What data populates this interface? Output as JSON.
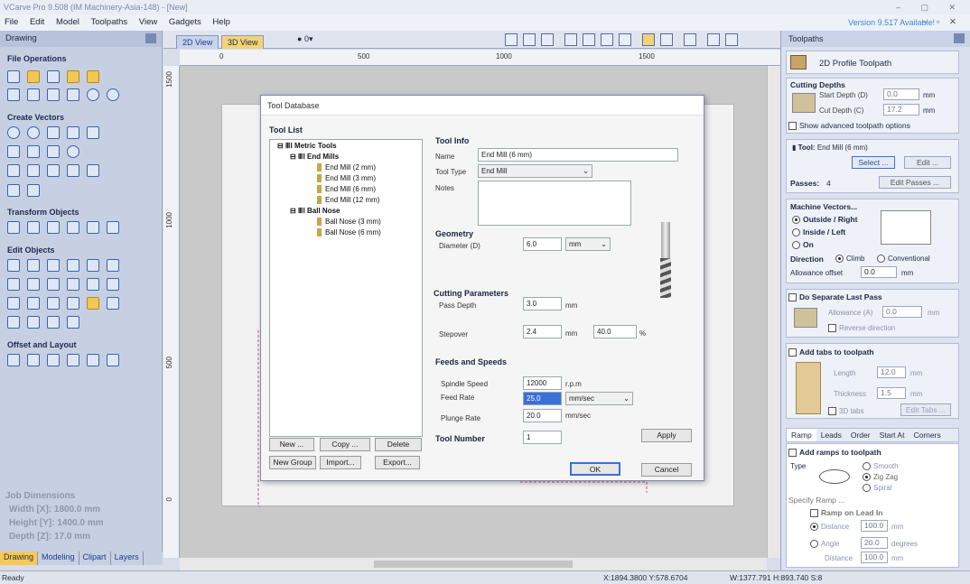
{
  "window": {
    "title": "VCarve Pro 9.508 (IM Machinery-Asia-148) - [New]",
    "version_notice": "Version 9.517 Available!"
  },
  "menu": [
    "File",
    "Edit",
    "Model",
    "Toolpaths",
    "View",
    "Gadgets",
    "Help"
  ],
  "left_panel": {
    "header": "Drawing",
    "sections": {
      "file_operations": "File Operations",
      "create_vectors": "Create Vectors",
      "transform_objects": "Transform Objects",
      "edit_objects": "Edit Objects",
      "offset_layout": "Offset and Layout"
    },
    "job_dimensions": {
      "title": "Job Dimensions",
      "width": "Width  [X]: 1800.0 mm",
      "height": "Height [Y]: 1400.0 mm",
      "depth": "Depth  [Z]: 17.0 mm"
    },
    "tabs": [
      "Drawing",
      "Modeling",
      "Clipart",
      "Layers"
    ],
    "active_tab": "Drawing"
  },
  "view_tabs": {
    "tab2d": "2D View",
    "tab3d": "3D View",
    "layer_label": "0"
  },
  "ruler": {
    "h": [
      "0",
      "500",
      "1000",
      "1500"
    ],
    "v": [
      "1500",
      "1000",
      "500",
      "0"
    ]
  },
  "status": {
    "left": "Ready",
    "coords": "X:1894.3800 Y:578.6704",
    "size": "W:1377.791  H:893.740  S:8"
  },
  "right_panel": {
    "header": "Toolpaths",
    "toolpath_title": "2D Profile Toolpath",
    "cutting_depths": {
      "title": "Cutting Depths",
      "start_label": "Start Depth (D)",
      "start_value": "0.0",
      "cut_label": "Cut Depth (C)",
      "cut_value": "17.2",
      "unit": "mm",
      "advanced": "Show advanced toolpath options"
    },
    "tool": {
      "label": "Tool:",
      "value": "End Mill (6 mm)",
      "select": "Select ...",
      "edit": "Edit ..."
    },
    "passes": {
      "label": "Passes:",
      "value": "4",
      "edit": "Edit Passes ..."
    },
    "machine_vectors": {
      "title": "Machine Vectors...",
      "outside": "Outside / Right",
      "inside": "Inside / Left",
      "on": "On",
      "direction": "Direction",
      "climb": "Climb",
      "conventional": "Conventional",
      "allowance_label": "Allowance offset",
      "allowance_value": "0.0",
      "unit": "mm"
    },
    "last_pass": {
      "title": "Do Separate Last Pass",
      "allowance_label": "Allowance (A)",
      "allowance_value": "0.0",
      "unit": "mm",
      "reverse": "Reverse direction"
    },
    "tabs_box": {
      "title": "Add tabs to toolpath",
      "length_label": "Length",
      "length_value": "12.0",
      "thickness_label": "Thickness",
      "thickness_value": "1.5",
      "unit": "mm",
      "tabs3d": "3D tabs",
      "edit": "Edit Tabs ..."
    },
    "bottom_tabs": [
      "Ramp",
      "Leads",
      "Order",
      "Start At",
      "Corners"
    ],
    "ramp": {
      "title": "Add ramps to toolpath",
      "type": "Type",
      "smooth": "Smooth",
      "zigzag": "Zig Zag",
      "spiral": "Spiral",
      "specify": "Specify Ramp ...",
      "lead_in": "Ramp on Lead In",
      "distance": "Distance",
      "distance_value": "100.0",
      "angle": "Angle",
      "angle_value": "20.0",
      "degrees": "degrees",
      "distance2": "Distance",
      "distance2_value": "100.0",
      "unit": "mm"
    }
  },
  "dialog": {
    "title": "Tool Database",
    "tool_list": "Tool List",
    "tree": {
      "root": "Metric Tools",
      "end_mills": "End Mills",
      "em": [
        "End Mill (2 mm)",
        "End Mill (3 mm)",
        "End Mill (6 mm)",
        "End Mill (12 mm)"
      ],
      "ball_nose": "Ball Nose",
      "bn": [
        "Ball Nose (3 mm)",
        "Ball Nose (6 mm)"
      ]
    },
    "list_buttons": {
      "new": "New ...",
      "copy": "Copy ...",
      "delete": "Delete",
      "new_group": "New Group",
      "import": "Import...",
      "export": "Export..."
    },
    "info": {
      "title": "Tool Info",
      "name_label": "Name",
      "name_value": "End Mill (6 mm)",
      "type_label": "Tool Type",
      "type_value": "End Mill",
      "notes_label": "Notes"
    },
    "geometry": {
      "title": "Geometry",
      "diameter_label": "Diameter (D)",
      "diameter_value": "6.0",
      "unit": "mm"
    },
    "cutting": {
      "title": "Cutting Parameters",
      "pass_depth_label": "Pass Depth",
      "pass_depth_value": "3.0",
      "unit": "mm",
      "stepover_label": "Stepover",
      "stepover_value": "2.4",
      "stepover_pct": "40.0",
      "pct": "%"
    },
    "feeds": {
      "title": "Feeds and Speeds",
      "spindle_label": "Spindle Speed",
      "spindle_value": "12000",
      "rpm": "r.p.m",
      "feed_label": "Feed Rate",
      "feed_value": "25.0",
      "feed_unit": "mm/sec",
      "plunge_label": "Plunge Rate",
      "plunge_value": "20.0",
      "plunge_unit": "mm/sec"
    },
    "tool_number": {
      "label": "Tool Number",
      "value": "1"
    },
    "apply": "Apply",
    "ok": "OK",
    "cancel": "Cancel"
  }
}
